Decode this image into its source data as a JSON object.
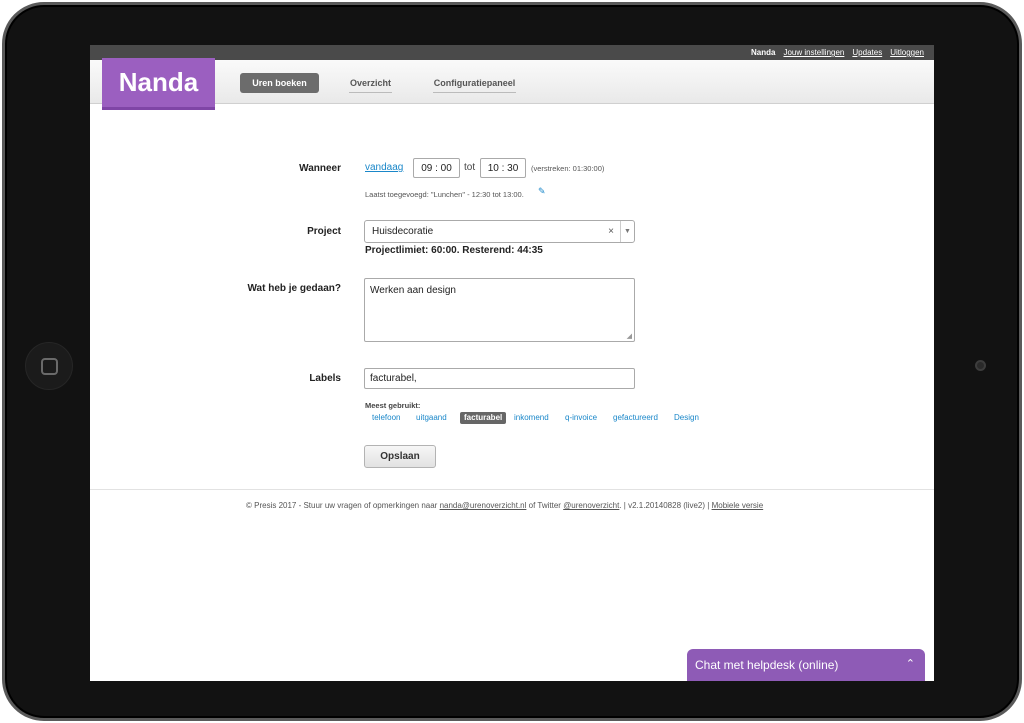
{
  "topbar": {
    "user": "Nanda",
    "links": [
      "Jouw instellingen",
      "Updates",
      "Uitloggen"
    ]
  },
  "header": {
    "logo": "Nanda",
    "tabs": [
      "Uren boeken",
      "Overzicht",
      "Configuratiepaneel"
    ],
    "active_tab": "Uren boeken"
  },
  "form": {
    "wanneer": {
      "label": "Wanneer",
      "date_link": "vandaag",
      "start": "09 : 00",
      "separator": "tot",
      "end": "10 : 30",
      "elapsed": "(verstreken: 01:30:00)",
      "last_added": "Laatst toegevoegd: \"Lunchen\" - 12:30 tot 13:00."
    },
    "project": {
      "label": "Project",
      "value": "Huisdecoratie",
      "clear": "×",
      "limit": "Projectlimiet: 60:00. Resterend: 44:35"
    },
    "activity": {
      "label": "Wat heb je gedaan?",
      "value": "Werken aan design"
    },
    "labels": {
      "label": "Labels",
      "value": "facturabel,",
      "most_used_title": "Meest gebruikt:",
      "most_used": [
        "telefoon",
        "uitgaand",
        "facturabel",
        "inkomend",
        "q-invoice",
        "gefactureerd",
        "Design"
      ],
      "selected": "facturabel"
    },
    "save_label": "Opslaan"
  },
  "footer": {
    "prefix": "© Presis 2017 - Stuur uw vragen of opmerkingen naar",
    "email": "nanda@urenoverzicht.nl",
    "twitter_text": "of Twitter",
    "twitter": "@urenoverzicht",
    "version": ". | v2.1.20140828 (live2) |",
    "mobile": "Mobiele versie"
  },
  "chat": {
    "label": "Chat met helpdesk (online)"
  },
  "colors": {
    "brand": "#9b5fc0",
    "link": "#1a87c9",
    "chat": "#8e5bb6"
  }
}
